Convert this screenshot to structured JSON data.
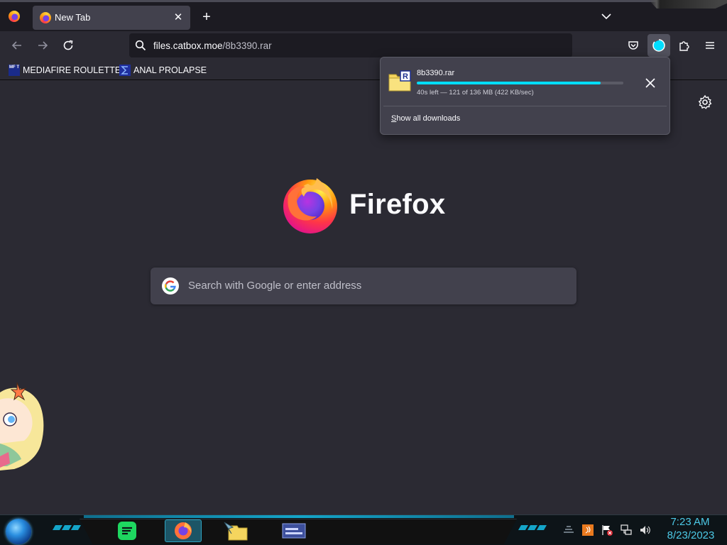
{
  "tabs": [
    {
      "label": "New Tab",
      "active": true
    }
  ],
  "urlbar": {
    "host": "files.catbox.moe",
    "path": "/8b3390.rar"
  },
  "bookmarks": [
    {
      "label": "MEDIAFIRE ROULETTER",
      "icon": "mft-icon",
      "icon_text": "MF T"
    },
    {
      "label": "ANAL PROLAPSE",
      "icon": "sigma-icon"
    }
  ],
  "newtab": {
    "brand": "Firefox",
    "search_placeholder": "Search with Google or enter address"
  },
  "downloads_panel": {
    "filename": "8b3390.rar",
    "status": "40s left — 121 of 136 MB (422 KB/sec)",
    "progress_fraction": 0.89,
    "show_all_label": "Show all downloads"
  },
  "taskbar": {
    "apps": [
      "spotify-icon",
      "firefox-icon",
      "explorer-icon",
      "window-icon"
    ],
    "clock_time": "7:23 AM",
    "clock_date": "8/23/2023"
  },
  "colors": {
    "accent": "#00ddff",
    "toolbar": "#2b2a33",
    "tabstrip": "#1c1b22",
    "panel": "#42414d",
    "taskbar_text": "#4cc9e6"
  }
}
